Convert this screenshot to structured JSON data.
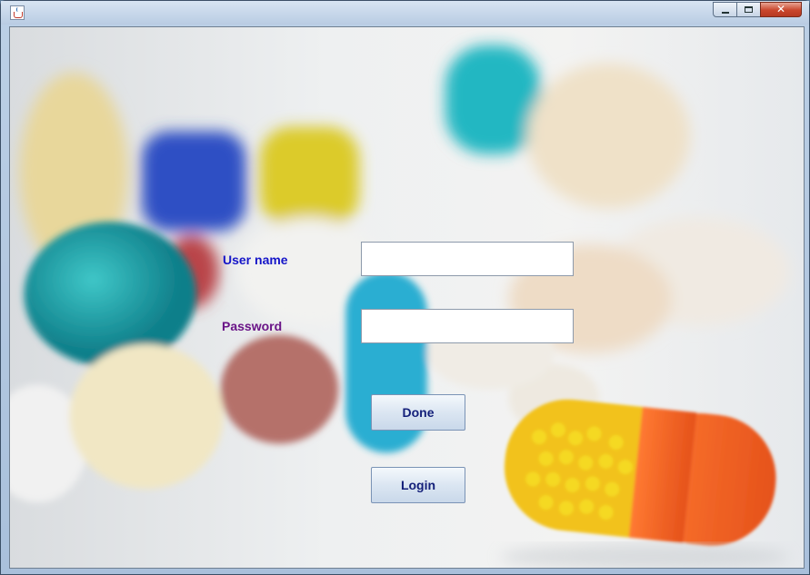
{
  "window": {
    "title": "",
    "icon": "java-icon",
    "controls": {
      "minimize": "minimize-icon",
      "maximize": "maximize-icon",
      "close": "close-icon"
    }
  },
  "form": {
    "username_label": "User name",
    "password_label": "Password",
    "username_value": "",
    "password_value": "",
    "done_button": "Done",
    "login_button": "Login"
  },
  "colors": {
    "username_label": "#1515c8",
    "password_label": "#6a1487",
    "button_text": "#14207a"
  }
}
